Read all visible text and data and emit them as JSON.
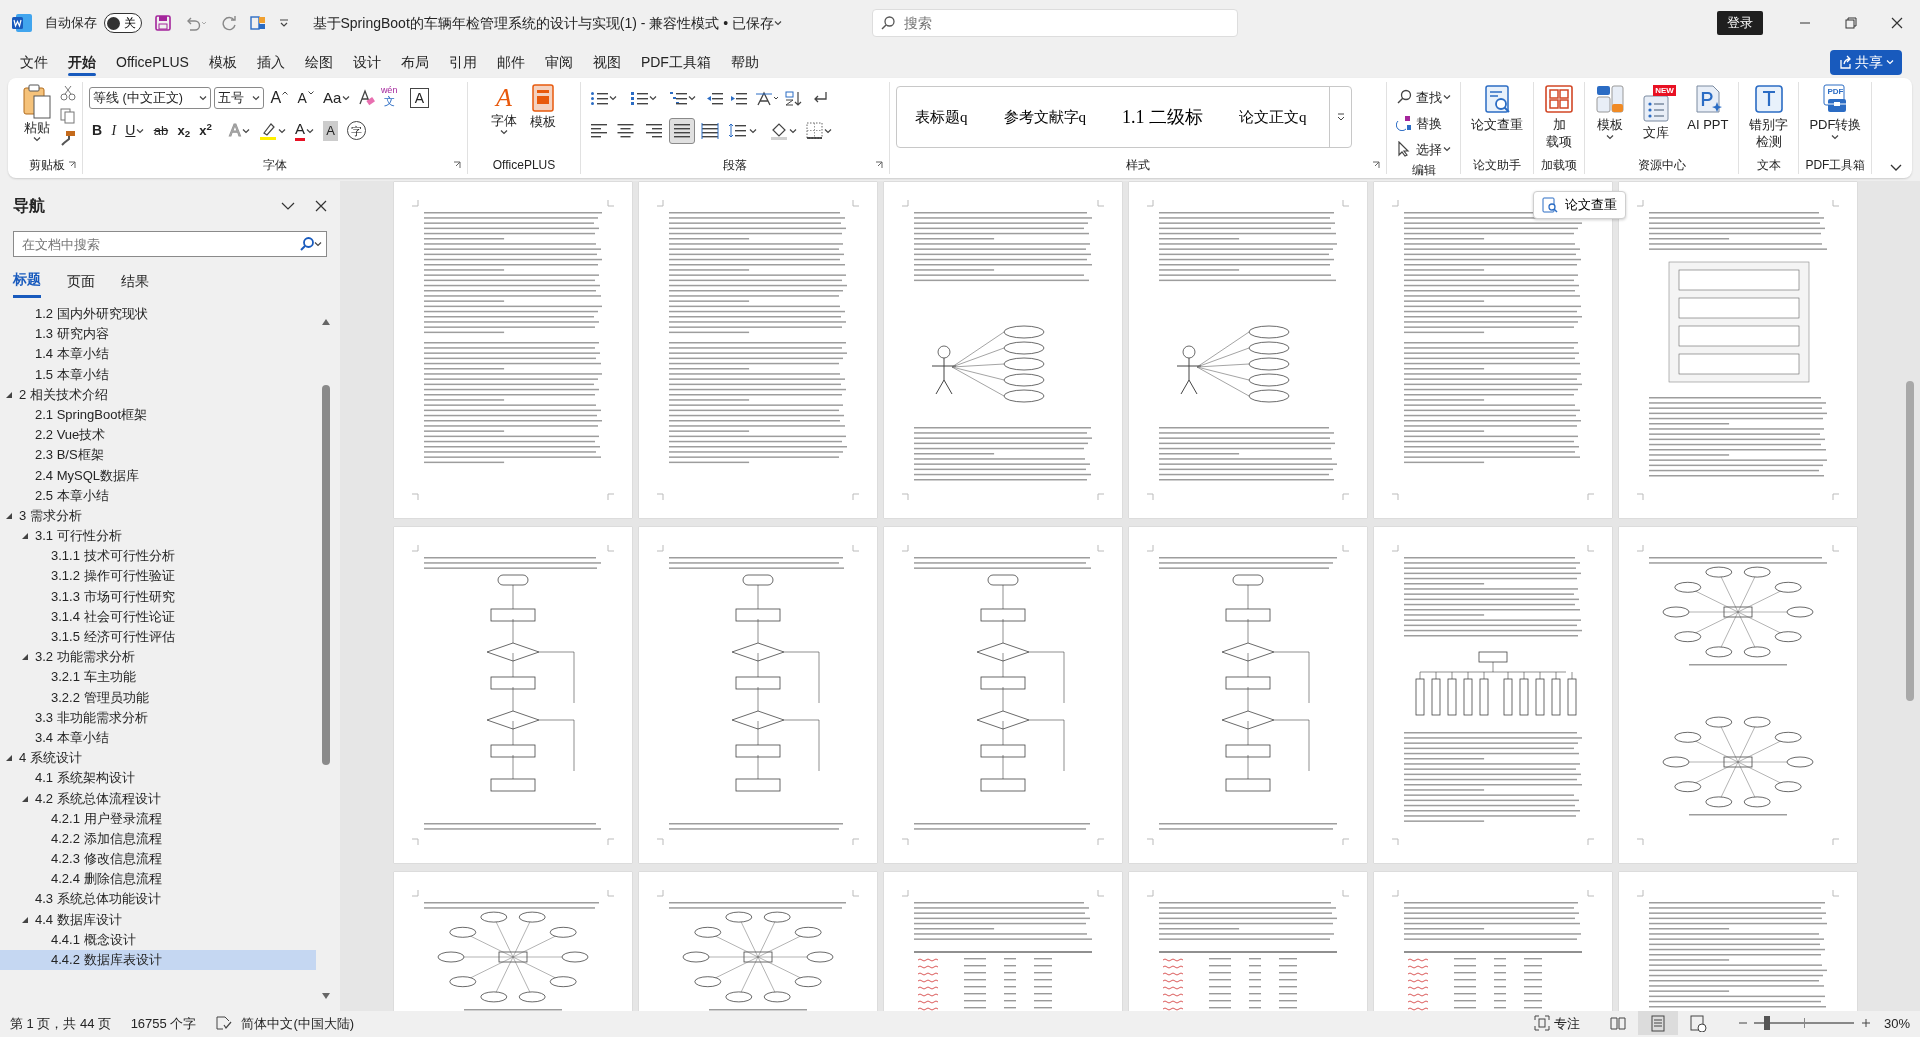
{
  "titlebar": {
    "autosave_label": "自动保存",
    "autosave": {
      "on": false,
      "label": "关"
    },
    "title": "基于SpringBoot的车辆年检管理系统的设计与实现(1)  -  兼容性模式 • 已保存",
    "search": {
      "placeholder": "搜索"
    },
    "login": "登录"
  },
  "menu_tabs": [
    {
      "label": "文件",
      "selected": false
    },
    {
      "label": "开始",
      "selected": true
    },
    {
      "label": "OfficePLUS",
      "selected": false
    },
    {
      "label": "模板",
      "selected": false
    },
    {
      "label": "插入",
      "selected": false
    },
    {
      "label": "绘图",
      "selected": false
    },
    {
      "label": "设计",
      "selected": false
    },
    {
      "label": "布局",
      "selected": false
    },
    {
      "label": "引用",
      "selected": false
    },
    {
      "label": "邮件",
      "selected": false
    },
    {
      "label": "审阅",
      "selected": false
    },
    {
      "label": "视图",
      "selected": false
    },
    {
      "label": "PDF工具箱",
      "selected": false
    },
    {
      "label": "帮助",
      "selected": false
    }
  ],
  "share": "共享",
  "ribbon": {
    "clipboard": {
      "label": "剪贴板",
      "paste": "粘贴"
    },
    "font": {
      "label": "字体",
      "font_name": "等线 (中文正文)",
      "font_size": "五号",
      "top_buttons": [
        {
          "kind": "grow",
          "label": "A"
        },
        {
          "kind": "shrink",
          "label": "A"
        },
        {
          "kind": "case",
          "label": "Aa"
        },
        {
          "kind": "clear"
        },
        {
          "kind": "pinyin",
          "label": "wén",
          "sub": "文"
        },
        {
          "kind": "border",
          "label": "A"
        }
      ],
      "format_buttons": [
        {
          "kind": "bold",
          "label": "B"
        },
        {
          "kind": "italic",
          "label": "I"
        },
        {
          "kind": "underline",
          "label": "U"
        },
        {
          "kind": "strike",
          "label": "ab"
        },
        {
          "kind": "sub",
          "label": "x$_{2}$"
        },
        {
          "kind": "sup",
          "label": "x$^{2}$"
        },
        {
          "kind": "effects",
          "label": "A"
        },
        {
          "kind": "highlight"
        },
        {
          "kind": "color",
          "label": "A"
        },
        {
          "kind": "shade",
          "label": "A"
        },
        {
          "kind": "circle",
          "label": "字"
        }
      ]
    },
    "officeplus": {
      "label": "OfficePLUS",
      "buttons": [
        {
          "kind": "font",
          "label": "字体",
          "icon_text": "A"
        },
        {
          "kind": "template",
          "label": "模板"
        }
      ]
    },
    "paragraph": {
      "label": "段落",
      "align_buttons": [
        {
          "kind": "left",
          "selected": false
        },
        {
          "kind": "center",
          "selected": false
        },
        {
          "kind": "right",
          "selected": false
        },
        {
          "kind": "justify",
          "selected": true
        },
        {
          "kind": "distributed",
          "selected": false
        }
      ]
    },
    "styles": {
      "label": "样式",
      "items": [
        {
          "kind": "normal",
          "label": "表标题q"
        },
        {
          "kind": "normal",
          "label": "参考文献字q"
        },
        {
          "kind": "heading",
          "label": "1.1  二级标"
        },
        {
          "kind": "normal",
          "label": "论文正文q"
        }
      ]
    },
    "editing": {
      "label": "编辑",
      "items": [
        {
          "kind": "find",
          "label": "查找"
        },
        {
          "kind": "replace",
          "label": "替换"
        },
        {
          "kind": "select",
          "label": "选择"
        }
      ]
    },
    "tool_groups": [
      {
        "label": "论文助手",
        "buttons": [
          {
            "kind": "check",
            "label": "论文查重"
          }
        ]
      },
      {
        "label": "加载项",
        "buttons": [
          {
            "kind": "grid",
            "label_lines": [
              "加",
              "载项"
            ]
          }
        ]
      },
      {
        "label": "资源中心",
        "buttons": [
          {
            "kind": "layout",
            "label": "模板"
          },
          {
            "kind": "library",
            "label": "文库",
            "badge": "NEW"
          },
          {
            "kind": "ppt",
            "label": "AI PPT"
          }
        ]
      },
      {
        "label": "文本",
        "buttons": [
          {
            "kind": "typo",
            "label_lines": [
              "错别字",
              "检测"
            ]
          }
        ]
      },
      {
        "label": "PDF工具箱",
        "buttons": [
          {
            "kind": "pdf",
            "label": "PDF转换",
            "badge_text": "PDF"
          }
        ]
      }
    ]
  },
  "navigation": {
    "title": "导航",
    "search": {
      "placeholder": "在文档中搜索"
    },
    "tabs": [
      {
        "label": "标题",
        "selected": true
      },
      {
        "label": "页面",
        "selected": false
      },
      {
        "label": "结果",
        "selected": false
      }
    ],
    "tree": [
      {
        "children": [
          {
            "label": "1.2 国内外研究现状",
            "selected": false
          },
          {
            "label": "1.3 研究内容",
            "selected": false
          },
          {
            "label": "1.4 本章小结",
            "selected": false
          },
          {
            "label": "1.5 本章小结",
            "selected": false
          }
        ]
      },
      {
        "label": "2 相关技术介绍",
        "selected": false,
        "expanded": true,
        "children": [
          {
            "label": "2.1 SpringBoot框架",
            "selected": false
          },
          {
            "label": "2.2 Vue技术",
            "selected": false
          },
          {
            "label": "2.3 B/S框架",
            "selected": false
          },
          {
            "label": "2.4 MySQL数据库",
            "selected": false
          },
          {
            "label": "2.5 本章小结",
            "selected": false
          }
        ]
      },
      {
        "label": "3 需求分析",
        "selected": false,
        "expanded": true,
        "children": [
          {
            "label": "3.1 可行性分析",
            "selected": false,
            "expanded": true,
            "children": [
              {
                "label": "3.1.1 技术可行性分析",
                "selected": false
              },
              {
                "label": "3.1.2 操作可行性验证",
                "selected": false
              },
              {
                "label": "3.1.3 市场可行性研究",
                "selected": false
              },
              {
                "label": "3.1.4 社会可行性论证",
                "selected": false
              },
              {
                "label": "3.1.5 经济可行性评估",
                "selected": false
              }
            ]
          },
          {
            "label": "3.2 功能需求分析",
            "selected": false,
            "expanded": true,
            "children": [
              {
                "label": "3.2.1 车主功能",
                "selected": false
              },
              {
                "label": "3.2.2 管理员功能",
                "selected": false
              }
            ]
          },
          {
            "label": "3.3 非功能需求分析",
            "selected": false
          },
          {
            "label": "3.4 本章小结",
            "selected": false
          }
        ]
      },
      {
        "label": "4 系统设计",
        "selected": false,
        "expanded": true,
        "children": [
          {
            "label": "4.1 系统架构设计",
            "selected": false
          },
          {
            "label": "4.2 系统总体流程设计",
            "selected": false,
            "expanded": true,
            "children": [
              {
                "label": "4.2.1 用户登录流程",
                "selected": false
              },
              {
                "label": "4.2.2 添加信息流程",
                "selected": false
              },
              {
                "label": "4.2.3 修改信息流程",
                "selected": false
              },
              {
                "label": "4.2.4 删除信息流程",
                "selected": false
              }
            ]
          },
          {
            "label": "4.3 系统总体功能设计",
            "selected": false
          },
          {
            "label": "4.4 数据库设计",
            "selected": false,
            "expanded": true,
            "children": [
              {
                "label": "4.4.1 概念设计",
                "selected": false
              },
              {
                "label": "4.4.2 数据库表设计",
                "selected": true
              }
            ]
          }
        ]
      }
    ]
  },
  "document": {
    "floating_button": "论文查重",
    "pages": [
      {
        "kind": "text"
      },
      {
        "kind": "text"
      },
      {
        "kind": "usecase"
      },
      {
        "kind": "usecase"
      },
      {
        "kind": "text"
      },
      {
        "kind": "arch"
      },
      {
        "kind": "flowchart"
      },
      {
        "kind": "flowchart"
      },
      {
        "kind": "flowchart"
      },
      {
        "kind": "flowchart"
      },
      {
        "kind": "tree"
      },
      {
        "kind": "er"
      },
      {
        "kind": "er"
      },
      {
        "kind": "er"
      },
      {
        "kind": "table"
      },
      {
        "kind": "table"
      },
      {
        "kind": "table"
      },
      {
        "kind": "text"
      }
    ]
  },
  "status_bar": {
    "page": "第 1 页，共 44 页",
    "words": "16755 个字",
    "language": "简体中文(中国大陆)",
    "focus": "专注",
    "views": [
      {
        "kind": "read",
        "selected": false
      },
      {
        "kind": "print",
        "selected": true
      },
      {
        "kind": "web",
        "selected": false
      }
    ],
    "zoom": {
      "level": 0.13,
      "label": "30%"
    }
  }
}
